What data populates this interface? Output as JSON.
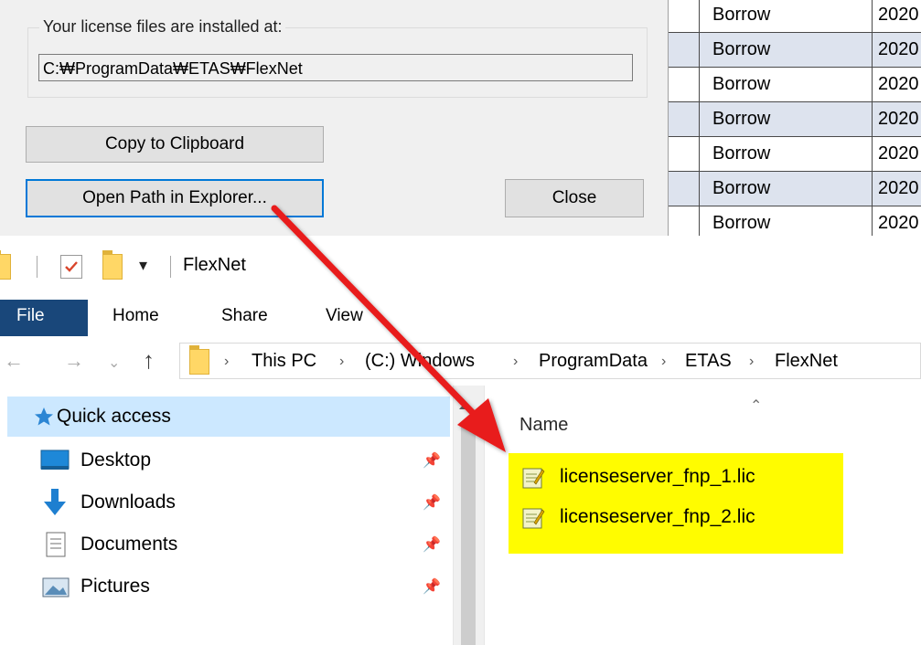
{
  "dialog": {
    "group_label": "Your license files are installed at:",
    "path": "C:₩ProgramData₩ETAS₩FlexNet",
    "copy_button": "Copy to Clipboard",
    "open_button": "Open Path in Explorer...",
    "close_button": "Close"
  },
  "table": {
    "rows": [
      {
        "type": "Borrow",
        "date": "2020"
      },
      {
        "type": "Borrow",
        "date": "2020"
      },
      {
        "type": "Borrow",
        "date": "2020"
      },
      {
        "type": "Borrow",
        "date": "2020"
      },
      {
        "type": "Borrow",
        "date": "2020"
      },
      {
        "type": "Borrow",
        "date": "2020"
      },
      {
        "type": "Borrow",
        "date": "2020"
      }
    ]
  },
  "explorer": {
    "title": "FlexNet",
    "ribbon_tabs": {
      "file": "File",
      "home": "Home",
      "share": "Share",
      "view": "View"
    },
    "breadcrumb": [
      "This PC",
      "(C:) Windows",
      "ProgramData",
      "ETAS",
      "FlexNet"
    ],
    "nav": {
      "quick_access": "Quick access",
      "items": [
        {
          "label": "Desktop",
          "icon": "desktop-icon"
        },
        {
          "label": "Downloads",
          "icon": "downloads-icon"
        },
        {
          "label": "Documents",
          "icon": "documents-icon"
        },
        {
          "label": "Pictures",
          "icon": "pictures-icon"
        }
      ]
    },
    "column_name": "Name",
    "files": [
      "licenseserver_fnp_1.lic",
      "licenseserver_fnp_2.lic"
    ]
  },
  "colors": {
    "highlight": "#fffc00",
    "arrow": "#e81a1a",
    "file_tab": "#19477a",
    "focus": "#0078d7"
  }
}
